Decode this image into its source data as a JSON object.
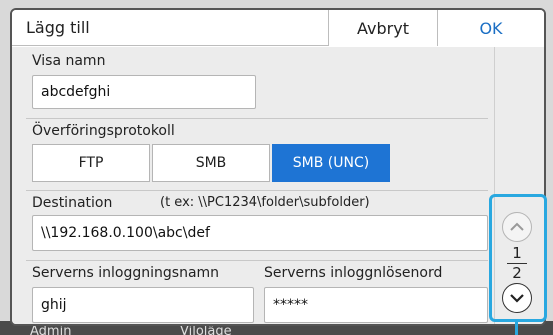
{
  "background": {
    "left_text": "Admin",
    "center_text": "Viloläge"
  },
  "dialog": {
    "title": "Lägg till",
    "cancel_label": "Avbryt",
    "ok_label": "OK"
  },
  "form": {
    "display_name": {
      "label": "Visa namn",
      "value": "abcdefghi"
    },
    "protocol": {
      "label": "Överföringsprotokoll",
      "options": [
        "FTP",
        "SMB",
        "SMB (UNC)"
      ],
      "selected": "SMB (UNC)"
    },
    "destination": {
      "label": "Destination",
      "hint": "(t ex: \\\\PC1234\\folder\\subfolder)",
      "value": "\\\\192.168.0.100\\abc\\def"
    },
    "login_name": {
      "label": "Serverns inloggningsnamn",
      "value": "ghij"
    },
    "login_password": {
      "label": "Serverns inloggnlösenord",
      "value": "*****"
    }
  },
  "pager": {
    "current": "1",
    "total": "2"
  },
  "colors": {
    "accent": "#1e74d4",
    "highlight": "#29a8e0",
    "ok_text": "#1b6fc4"
  }
}
